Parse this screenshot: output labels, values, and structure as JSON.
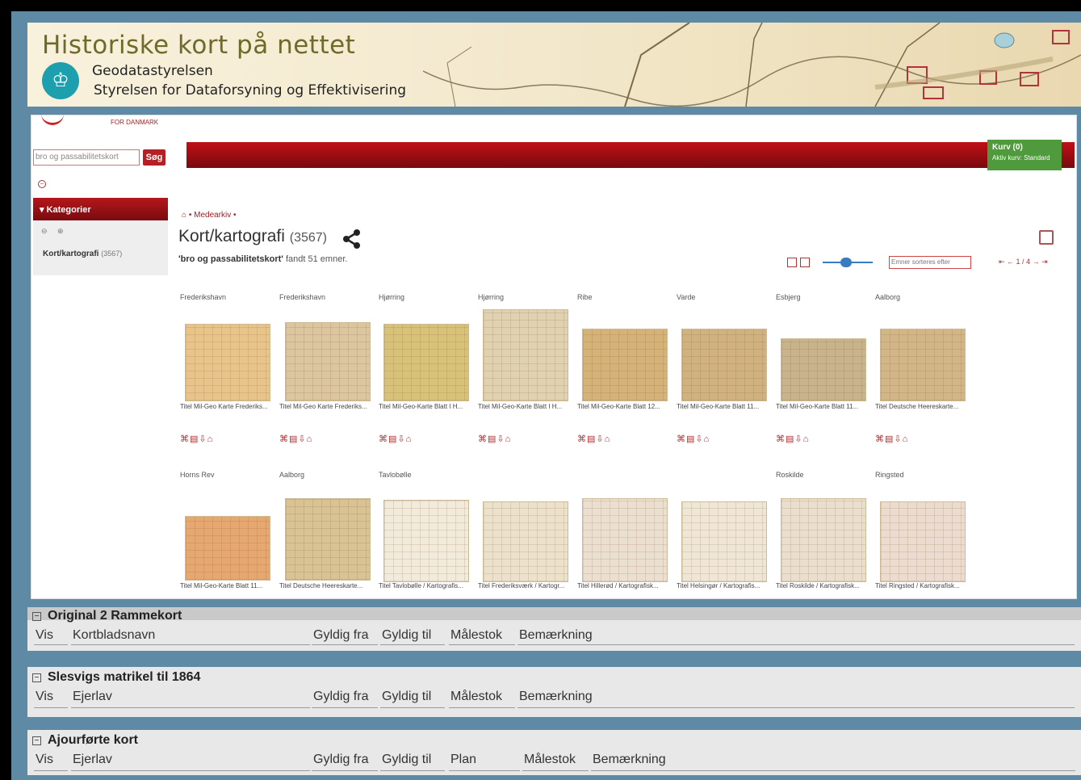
{
  "header": {
    "title": "Historiske kort på nettet",
    "org_line1": "Geodatastyrelsen",
    "org_line2": "Styrelsen for Dataforsyning og Effektivisering"
  },
  "embedded": {
    "nav_ref": "FOR DANMARK",
    "search_value": "bro og passabilitetskort",
    "search_button": "Søg",
    "cart_label": "Kurv (0)",
    "cart_sub": "Aktiv kurv: Standard",
    "categories_header": "Kategorier",
    "category_item": "Kort/kartografi",
    "category_item_count": "(3567)",
    "breadcrumb": "Medearkiv",
    "page_title": "Kort/kartografi",
    "page_title_count": "(3567)",
    "found_query": "'bro og passabilitetskort'",
    "found_text": "fandt 51 emner.",
    "sort_value": "Emner sorteres efter",
    "pager": "1 / 4"
  },
  "results": [
    {
      "place": "Frederikshavn",
      "caption": "Titel Mil-Geo Karte Frederiks...",
      "color": "#e9c48a"
    },
    {
      "place": "Frederikshavn",
      "caption": "Titel Mil-Geo Karte Frederiks...",
      "color": "#dcc6a0"
    },
    {
      "place": "Hjørring",
      "caption": "Titel Mil-Geo-Karte Blatt I H...",
      "color": "#d8c27a"
    },
    {
      "place": "Hjørring",
      "caption": "Titel Mil-Geo-Karte Blatt I H...",
      "color": "#e0d2b0"
    },
    {
      "place": "Ribe",
      "caption": "Titel Mil-Geo-Karte Blatt 12...",
      "color": "#d4b278"
    },
    {
      "place": "Varde",
      "caption": "Titel Mil-Geo-Karte Blatt 11...",
      "color": "#d0b180"
    },
    {
      "place": "Esbjerg",
      "caption": "Titel Mil-Geo-Karte Blatt 11...",
      "color": "#c8b48c"
    },
    {
      "place": "Aalborg",
      "caption": "Titel Deutsche Heereskarte...",
      "color": "#d2b687"
    },
    {
      "place": "Horns Rev",
      "caption": "Titel Mil-Geo-Karte Blatt 11...",
      "color": "#e6a870"
    },
    {
      "place": "Aalborg",
      "caption": "Titel Deutsche Heereskarte...",
      "color": "#d9c293"
    },
    {
      "place": "Tavlobølle",
      "caption": "Titel Tavlobølle / Kartografis...",
      "color": "#f2ebdc"
    },
    {
      "place": "",
      "caption": "Titel Frederiksværk / Kartogr...",
      "color": "#ece2cc"
    },
    {
      "place": "",
      "caption": "Titel Hillerød / Kartografisk...",
      "color": "#ebdfd0"
    },
    {
      "place": "",
      "caption": "Titel Helsingør / Kartografis...",
      "color": "#efe6d6"
    },
    {
      "place": "Roskilde",
      "caption": "Titel Roskilde / Kartografisk...",
      "color": "#e9dfcc"
    },
    {
      "place": "Ringsted",
      "caption": "Titel Ringsted / Kartografisk...",
      "color": "#ecdccf"
    }
  ],
  "panels": [
    {
      "title": "Original 2 Rammekort",
      "columns": [
        "Vis",
        "Kortbladsnavn",
        "Gyldig fra",
        "Gyldig til",
        "Målestok",
        "Bemærkning"
      ]
    },
    {
      "title": "Slesvigs matrikel til 1864",
      "columns": [
        "Vis",
        "Ejerlav",
        "Gyldig fra",
        "Gyldig til",
        "Målestok",
        "Bemærkning"
      ]
    },
    {
      "title": "Ajourførte kort",
      "columns": [
        "Vis",
        "Ejerlav",
        "Gyldig fra",
        "Gyldig til",
        "Plan",
        "Målestok",
        "Bemærkning"
      ]
    }
  ]
}
